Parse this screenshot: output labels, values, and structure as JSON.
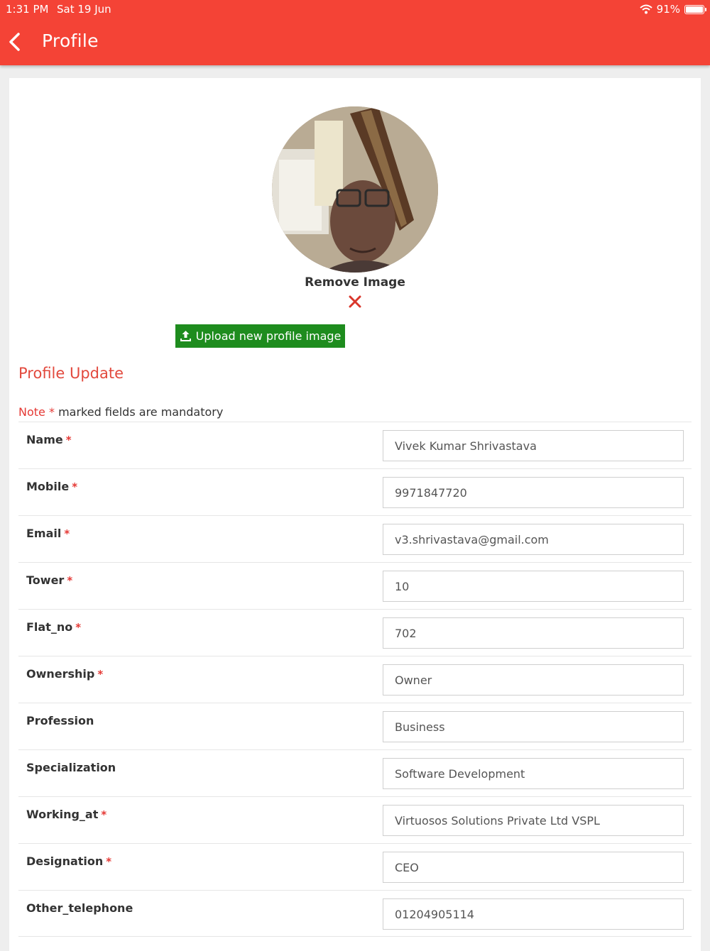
{
  "status_bar": {
    "time": "1:31 PM",
    "date": "Sat 19 Jun",
    "battery": "91%",
    "battery_level": 0.91
  },
  "header": {
    "title": "Profile"
  },
  "profile": {
    "remove_image_label": "Remove Image",
    "upload_label": "Upload new profile image"
  },
  "form": {
    "section_title": "Profile Update",
    "note_label": "Note",
    "note_star": "*",
    "note_text": "marked fields are mandatory",
    "fields": [
      {
        "label": "Name",
        "required": "*",
        "value": "Vivek Kumar Shrivastava"
      },
      {
        "label": "Mobile",
        "required": "*",
        "value": "9971847720"
      },
      {
        "label": "Email",
        "required": "*",
        "value": "v3.shrivastava@gmail.com"
      },
      {
        "label": "Tower",
        "required": "*",
        "value": "10"
      },
      {
        "label": "Flat_no",
        "required": "*",
        "value": "702"
      },
      {
        "label": "Ownership",
        "required": "*",
        "value": "Owner"
      },
      {
        "label": "Profession",
        "required": "",
        "value": "Business"
      },
      {
        "label": "Specialization",
        "required": "",
        "value": "Software Development"
      },
      {
        "label": "Working_at",
        "required": "*",
        "value": "Virtuosos Solutions Private Ltd VSPL"
      },
      {
        "label": "Designation",
        "required": "*",
        "value": "CEO"
      },
      {
        "label": "Other_telephone",
        "required": "",
        "value": "01204905114"
      }
    ]
  },
  "colors": {
    "header": "#f44336",
    "accent_text": "#e2493d",
    "required": "#e53935",
    "upload_button": "#1e8c1e"
  }
}
